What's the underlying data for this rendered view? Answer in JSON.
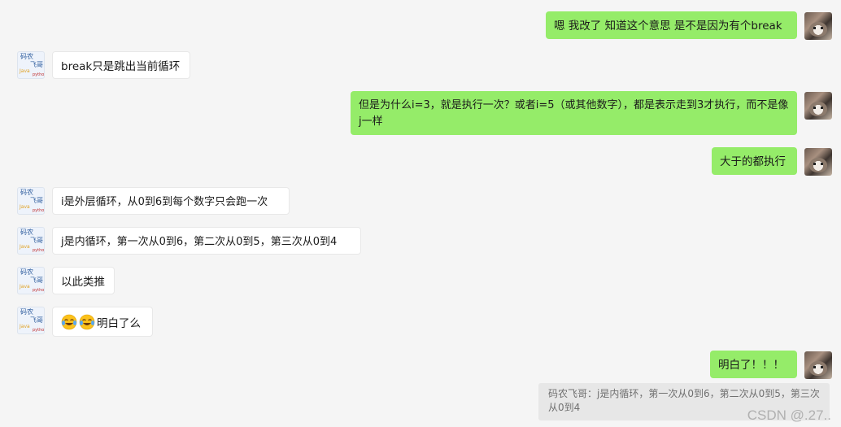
{
  "messages": {
    "m1": "嗯 我改了 知道这个意思 是不是因为有个break",
    "m2": "break只是跳出当前循环",
    "m3": "但是为什么i=3，就是执行一次？或者i=5（或其他数字），都是表示走到3才执行，而不是像j一样",
    "m4": "大于的都执行",
    "m5": "i是外层循环，从0到6到每个数字只会跑一次",
    "m6": "j是内循环，第一次从0到6，第二次从0到5，第三次从0到4",
    "m7": "以此类推",
    "m8": "明白了么",
    "m9": "明白了！！！"
  },
  "quote": "码农飞哥：j是内循环，第一次从0到6，第二次从0到5，第三次从0到4",
  "avatar_logo": {
    "line1": "码农",
    "line2": "飞哥",
    "line3": "Java",
    "line4": "python"
  },
  "icons": {
    "self_avatar": "cat-avatar",
    "other_avatar": "coder-logo-avatar",
    "emoji": "tears-of-joy-emoji"
  },
  "colors": {
    "self_bubble": "#95ec69",
    "other_bubble": "#ffffff",
    "background": "#f5f5f5"
  },
  "watermark": "CSDN @.27.."
}
